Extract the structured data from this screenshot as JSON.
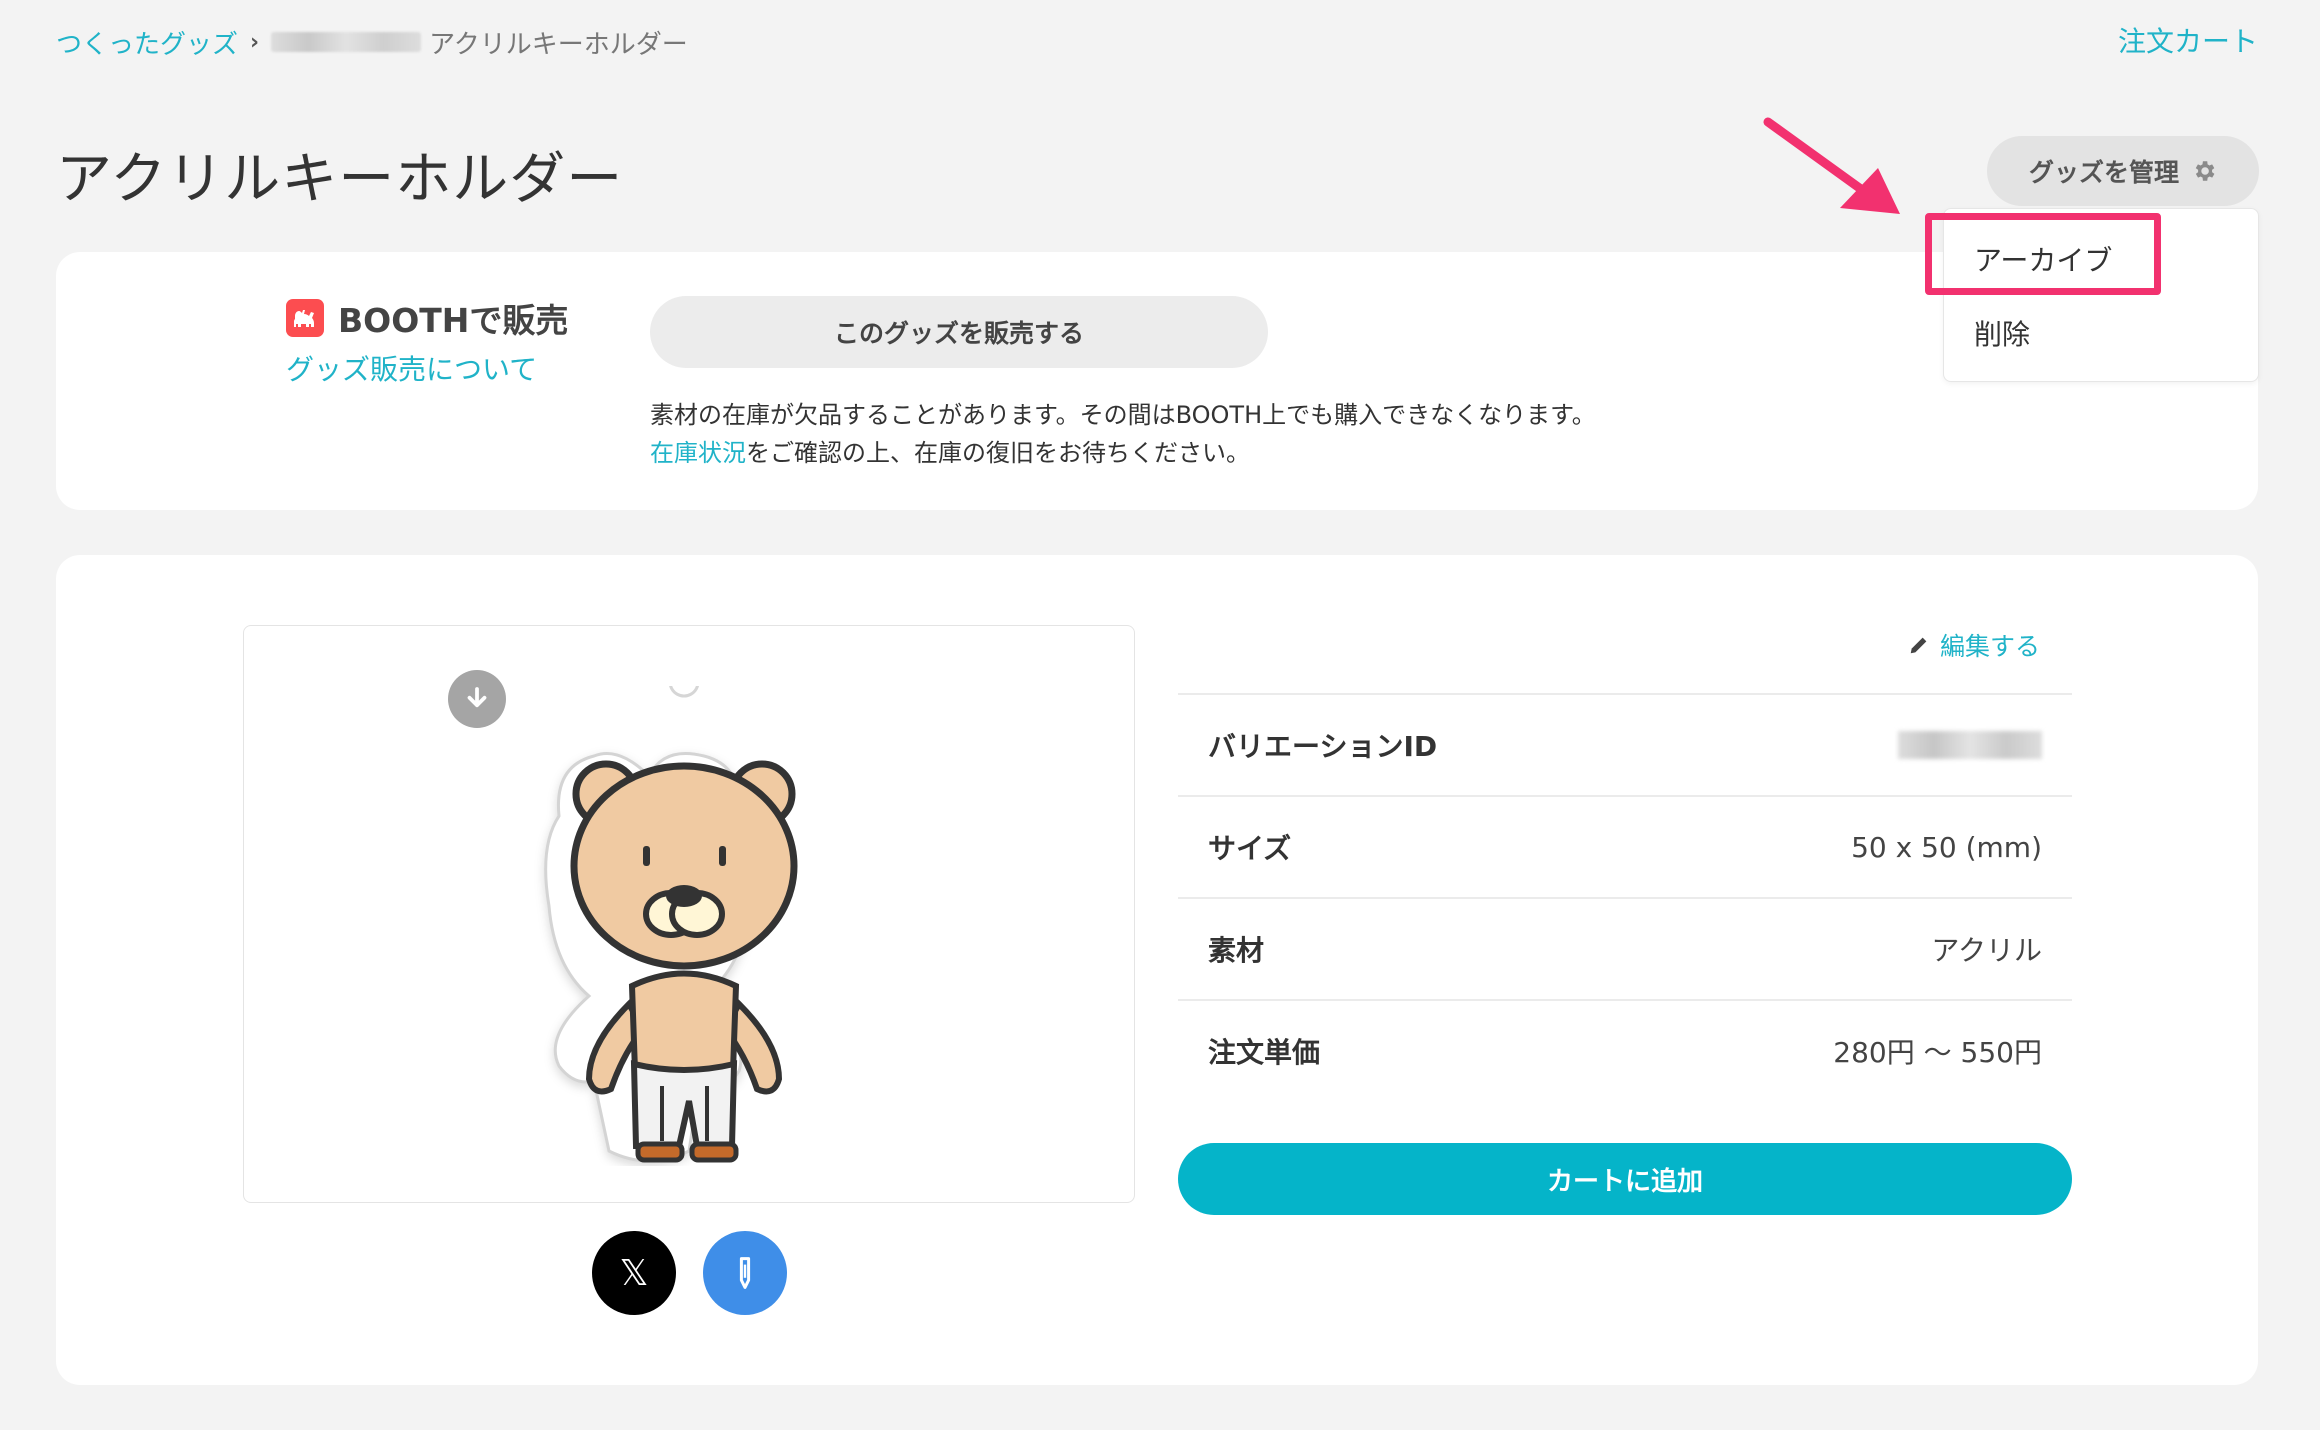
{
  "breadcrumb": {
    "root": "つくったグッズ",
    "current": "アクリルキーホルダー"
  },
  "header": {
    "cart_link": "注文カート",
    "title": "アクリルキーホルダー",
    "manage_button": "グッズを管理"
  },
  "manage_menu": {
    "items": [
      "アーカイブ",
      "削除"
    ]
  },
  "booth": {
    "title": "BOOTHで販売",
    "about_link": "グッズ販売について",
    "sell_button": "このグッズを販売する",
    "notice_line1": "素材の在庫が欠品することがあります。その間はBOOTH上でも購入できなくなります。",
    "notice_link": "在庫状況",
    "notice_line2_rest": "をご確認の上、在庫の復旧をお待ちください。"
  },
  "product": {
    "edit_link": "編集する",
    "share_x_label": "𝕏",
    "specs": [
      {
        "label": "バリエーションID",
        "value": ""
      },
      {
        "label": "サイズ",
        "value": "50 x 50 (mm)"
      },
      {
        "label": "素材",
        "value": "アクリル"
      },
      {
        "label": "注文単価",
        "value": "280円 〜 550円"
      }
    ],
    "add_to_cart": "カートに追加"
  },
  "colors": {
    "accent": "#20b3c8",
    "cart_button": "#05b4c9",
    "highlight": "#f2316f",
    "booth_red": "#fc4d50"
  },
  "icons": [
    "chevron-right-icon",
    "gear-icon",
    "booth-logo-icon",
    "download-icon",
    "pencil-icon",
    "x-logo-icon",
    "pen-icon",
    "annotation-arrow"
  ]
}
